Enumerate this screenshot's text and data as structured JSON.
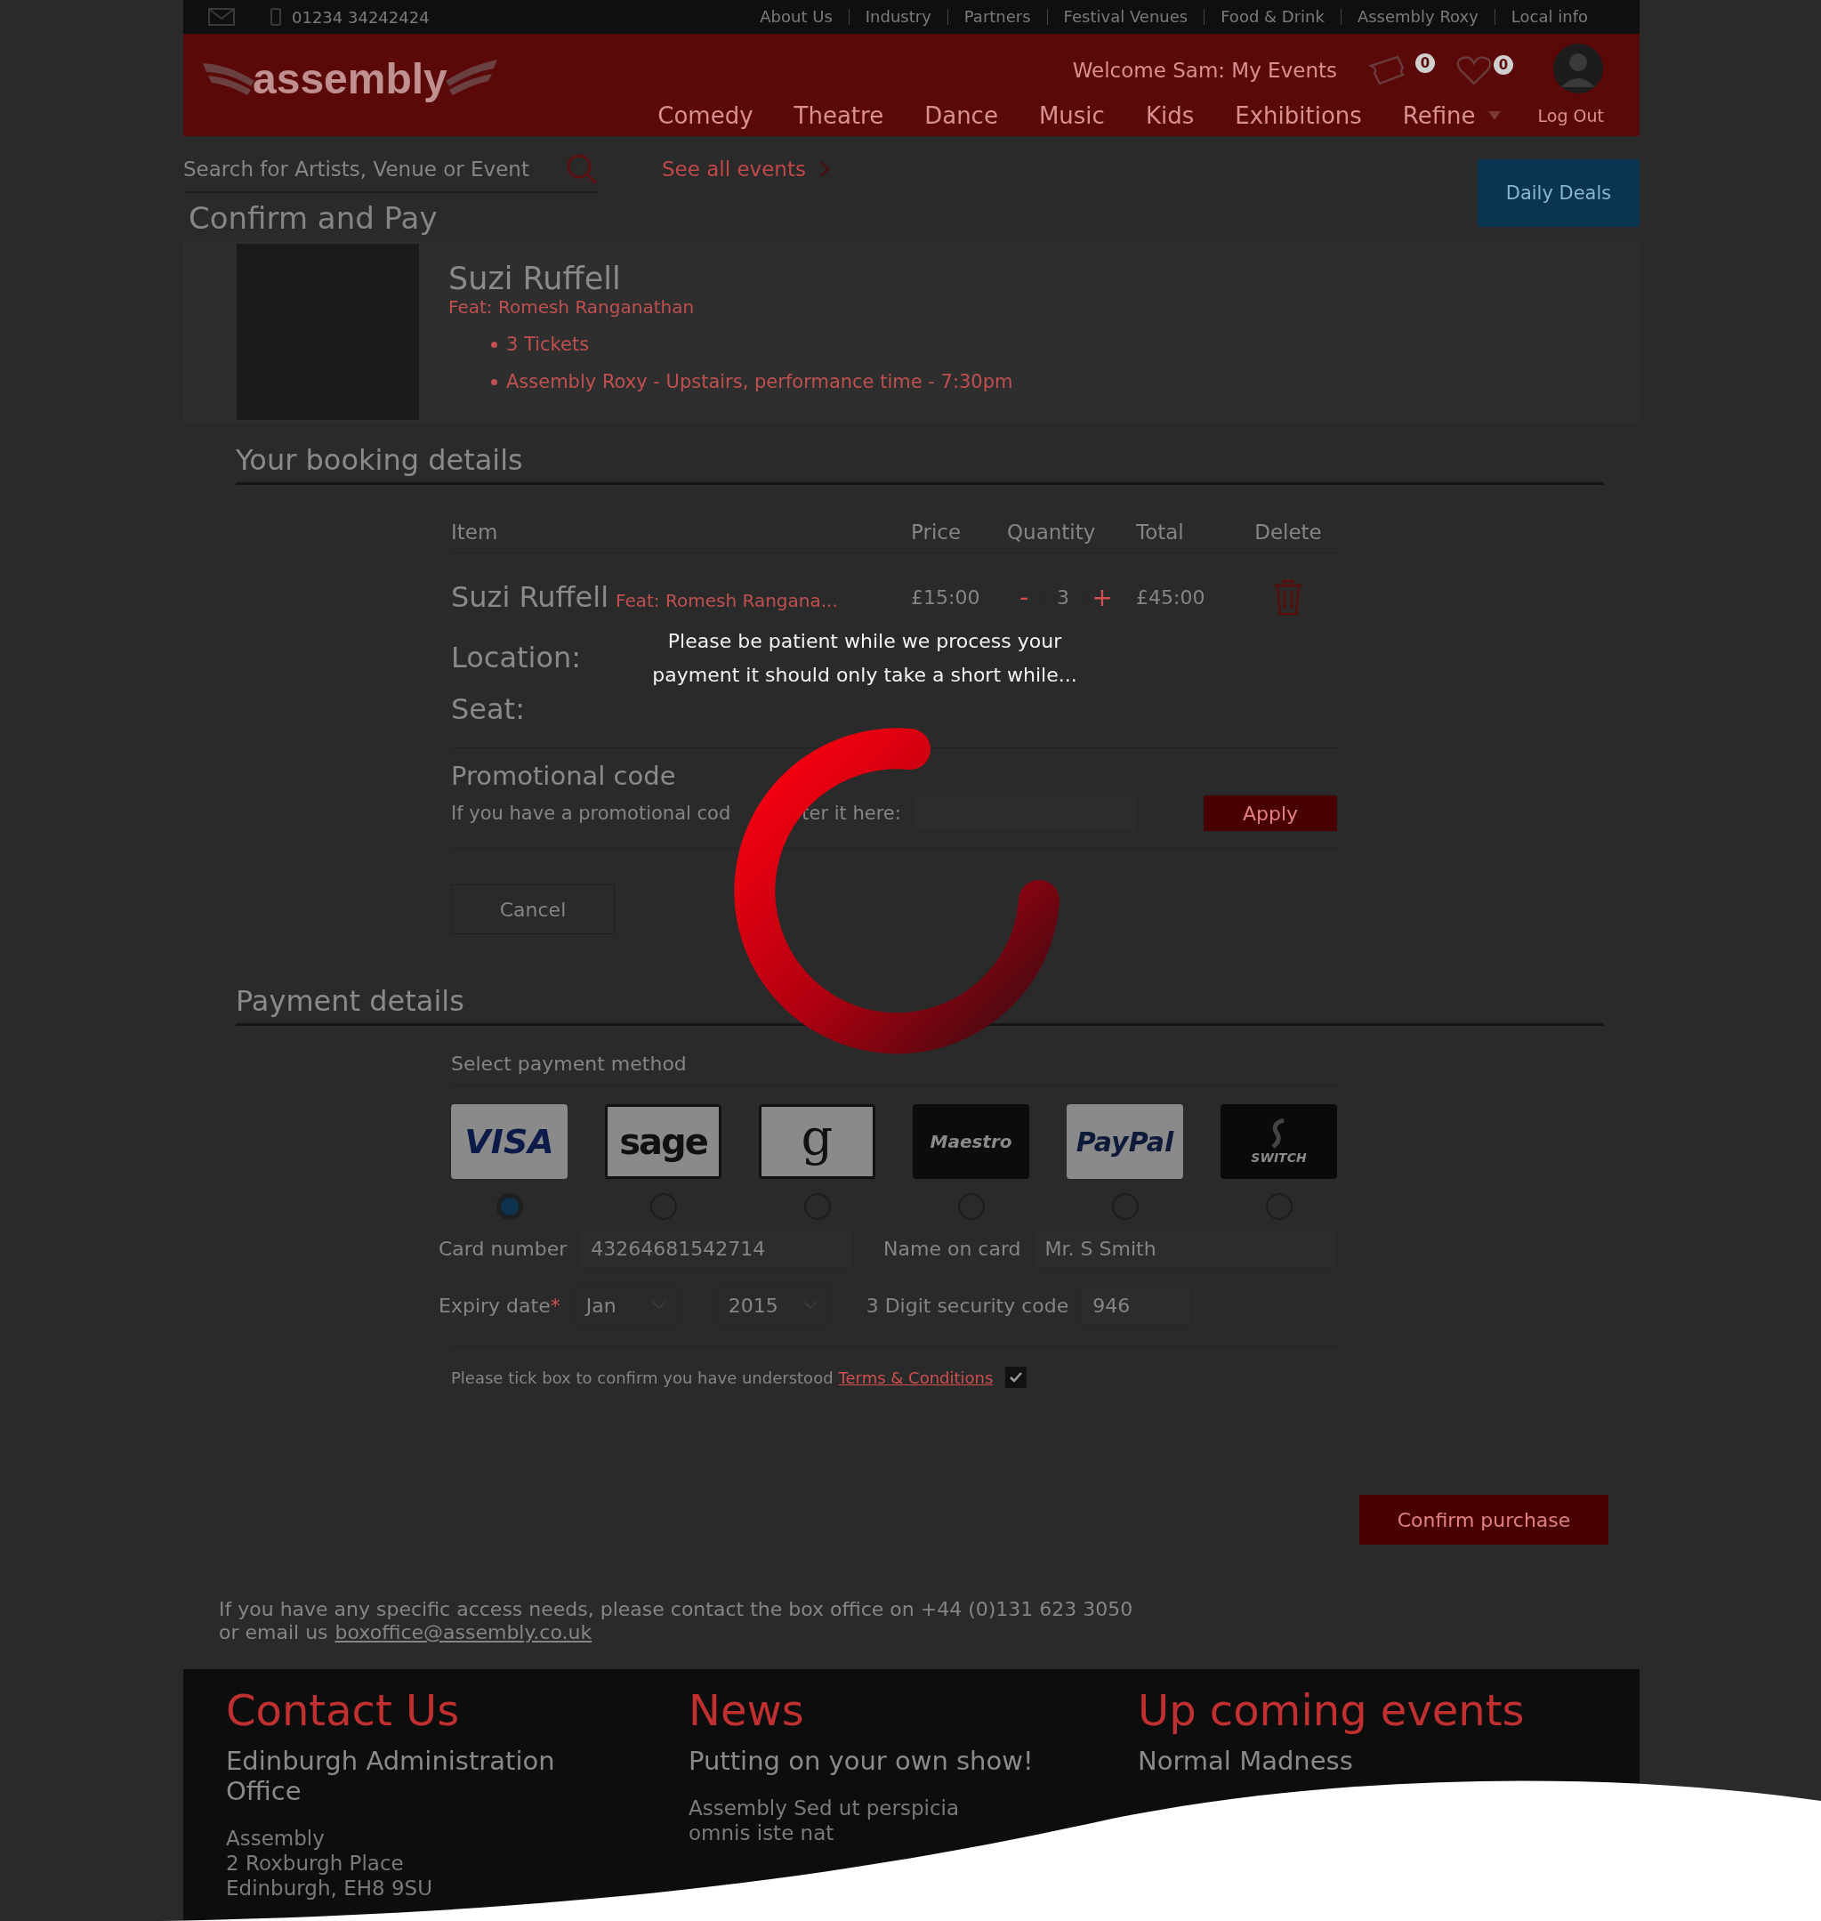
{
  "top_bar": {
    "phone": "01234 34242424",
    "links": [
      "About Us",
      "Industry",
      "Partners",
      "Festival Venues",
      "Food & Drink",
      "Assembly Roxy",
      "Local info"
    ]
  },
  "header": {
    "logo": "assembly",
    "welcome": "Welcome Sam: My Events",
    "tickets_count": "0",
    "favourites_count": "0",
    "logout": "Log Out",
    "nav": [
      {
        "label": "Comedy",
        "kind": "link"
      },
      {
        "label": "Theatre",
        "kind": "link"
      },
      {
        "label": "Dance",
        "kind": "link"
      },
      {
        "label": "Music",
        "kind": "link"
      },
      {
        "label": "Kids",
        "kind": "link"
      },
      {
        "label": "Exhibitions",
        "kind": "link"
      },
      {
        "label": "Refine",
        "kind": "dropdown"
      }
    ]
  },
  "search": {
    "placeholder": "Search for Artists, Venue or Event"
  },
  "see_all": "See all events",
  "daily_deals": "Daily Deals",
  "page_title": "Confirm and Pay",
  "event": {
    "title": "Suzi Ruffell",
    "feat": "Feat: Romesh Ranganathan",
    "bullets": [
      "3 Tickets",
      "Assembly Roxy - Upstairs, performance time - 7:30pm"
    ]
  },
  "booking": {
    "heading": "Your booking details",
    "columns": [
      "Item",
      "Price",
      "Quantity",
      "Total",
      "Delete"
    ],
    "item": {
      "name": "Suzi Ruffell",
      "feat": "Feat:  Romesh Rangana...",
      "price": "£15:00",
      "minus": "-",
      "quantity": "3",
      "plus": "+",
      "total": "£45:00"
    },
    "location_label": "Location:",
    "seat_label": "Seat:"
  },
  "promo": {
    "heading": "Promotional code",
    "hint_parts": [
      "If you have a promotional cod",
      "ter it here:"
    ],
    "apply": "Apply"
  },
  "cancel": "Cancel",
  "payment": {
    "heading": "Payment details",
    "select_label": "Select payment method",
    "methods": [
      {
        "kind": "visa",
        "label": "VISA",
        "selected": true
      },
      {
        "kind": "sage",
        "label": "sage",
        "selected": false
      },
      {
        "kind": "google",
        "label": "g",
        "selected": false
      },
      {
        "kind": "maestro",
        "label": "Maestro",
        "selected": false
      },
      {
        "kind": "paypal",
        "label": "PayPal",
        "selected": false
      },
      {
        "kind": "switch",
        "label": "SWITCH",
        "selected": false
      }
    ],
    "card_number": {
      "label": "Card number",
      "value": "43264681542714"
    },
    "name_on_card": {
      "label": "Name on card",
      "value": "Mr. S Smith"
    },
    "expiry": {
      "label": "Expiry date",
      "required_mark": "*",
      "month": "Jan",
      "year": "2015"
    },
    "security": {
      "label": "3 Digit security code",
      "value": "946"
    },
    "terms": {
      "text": "Please tick box to confirm you have understood",
      "link": "Terms & Conditions",
      "checked": true
    },
    "confirm": "Confirm purchase"
  },
  "access_note": {
    "line1": "If you have any specific access needs, please contact the box office on +44 (0)131 623 3050",
    "line2_prefix": "or email us",
    "email": "boxoffice@assembly.co.uk"
  },
  "footer": {
    "columns": [
      {
        "heading": "Contact Us",
        "title": "Edinburgh Administration Office",
        "lines": [
          "Assembly",
          "2 Roxburgh Place",
          "Edinburgh, EH8 9SU"
        ]
      },
      {
        "heading": "News",
        "title": "Putting on your own show!",
        "lines": [
          "Assembly Sed ut perspicia",
          "omnis iste nat"
        ]
      },
      {
        "heading": "Up coming events",
        "title": "Normal Madness"
      }
    ]
  },
  "overlay": {
    "message_lines": [
      "Please be patient while we process your",
      "payment it should only take a short while..."
    ]
  }
}
